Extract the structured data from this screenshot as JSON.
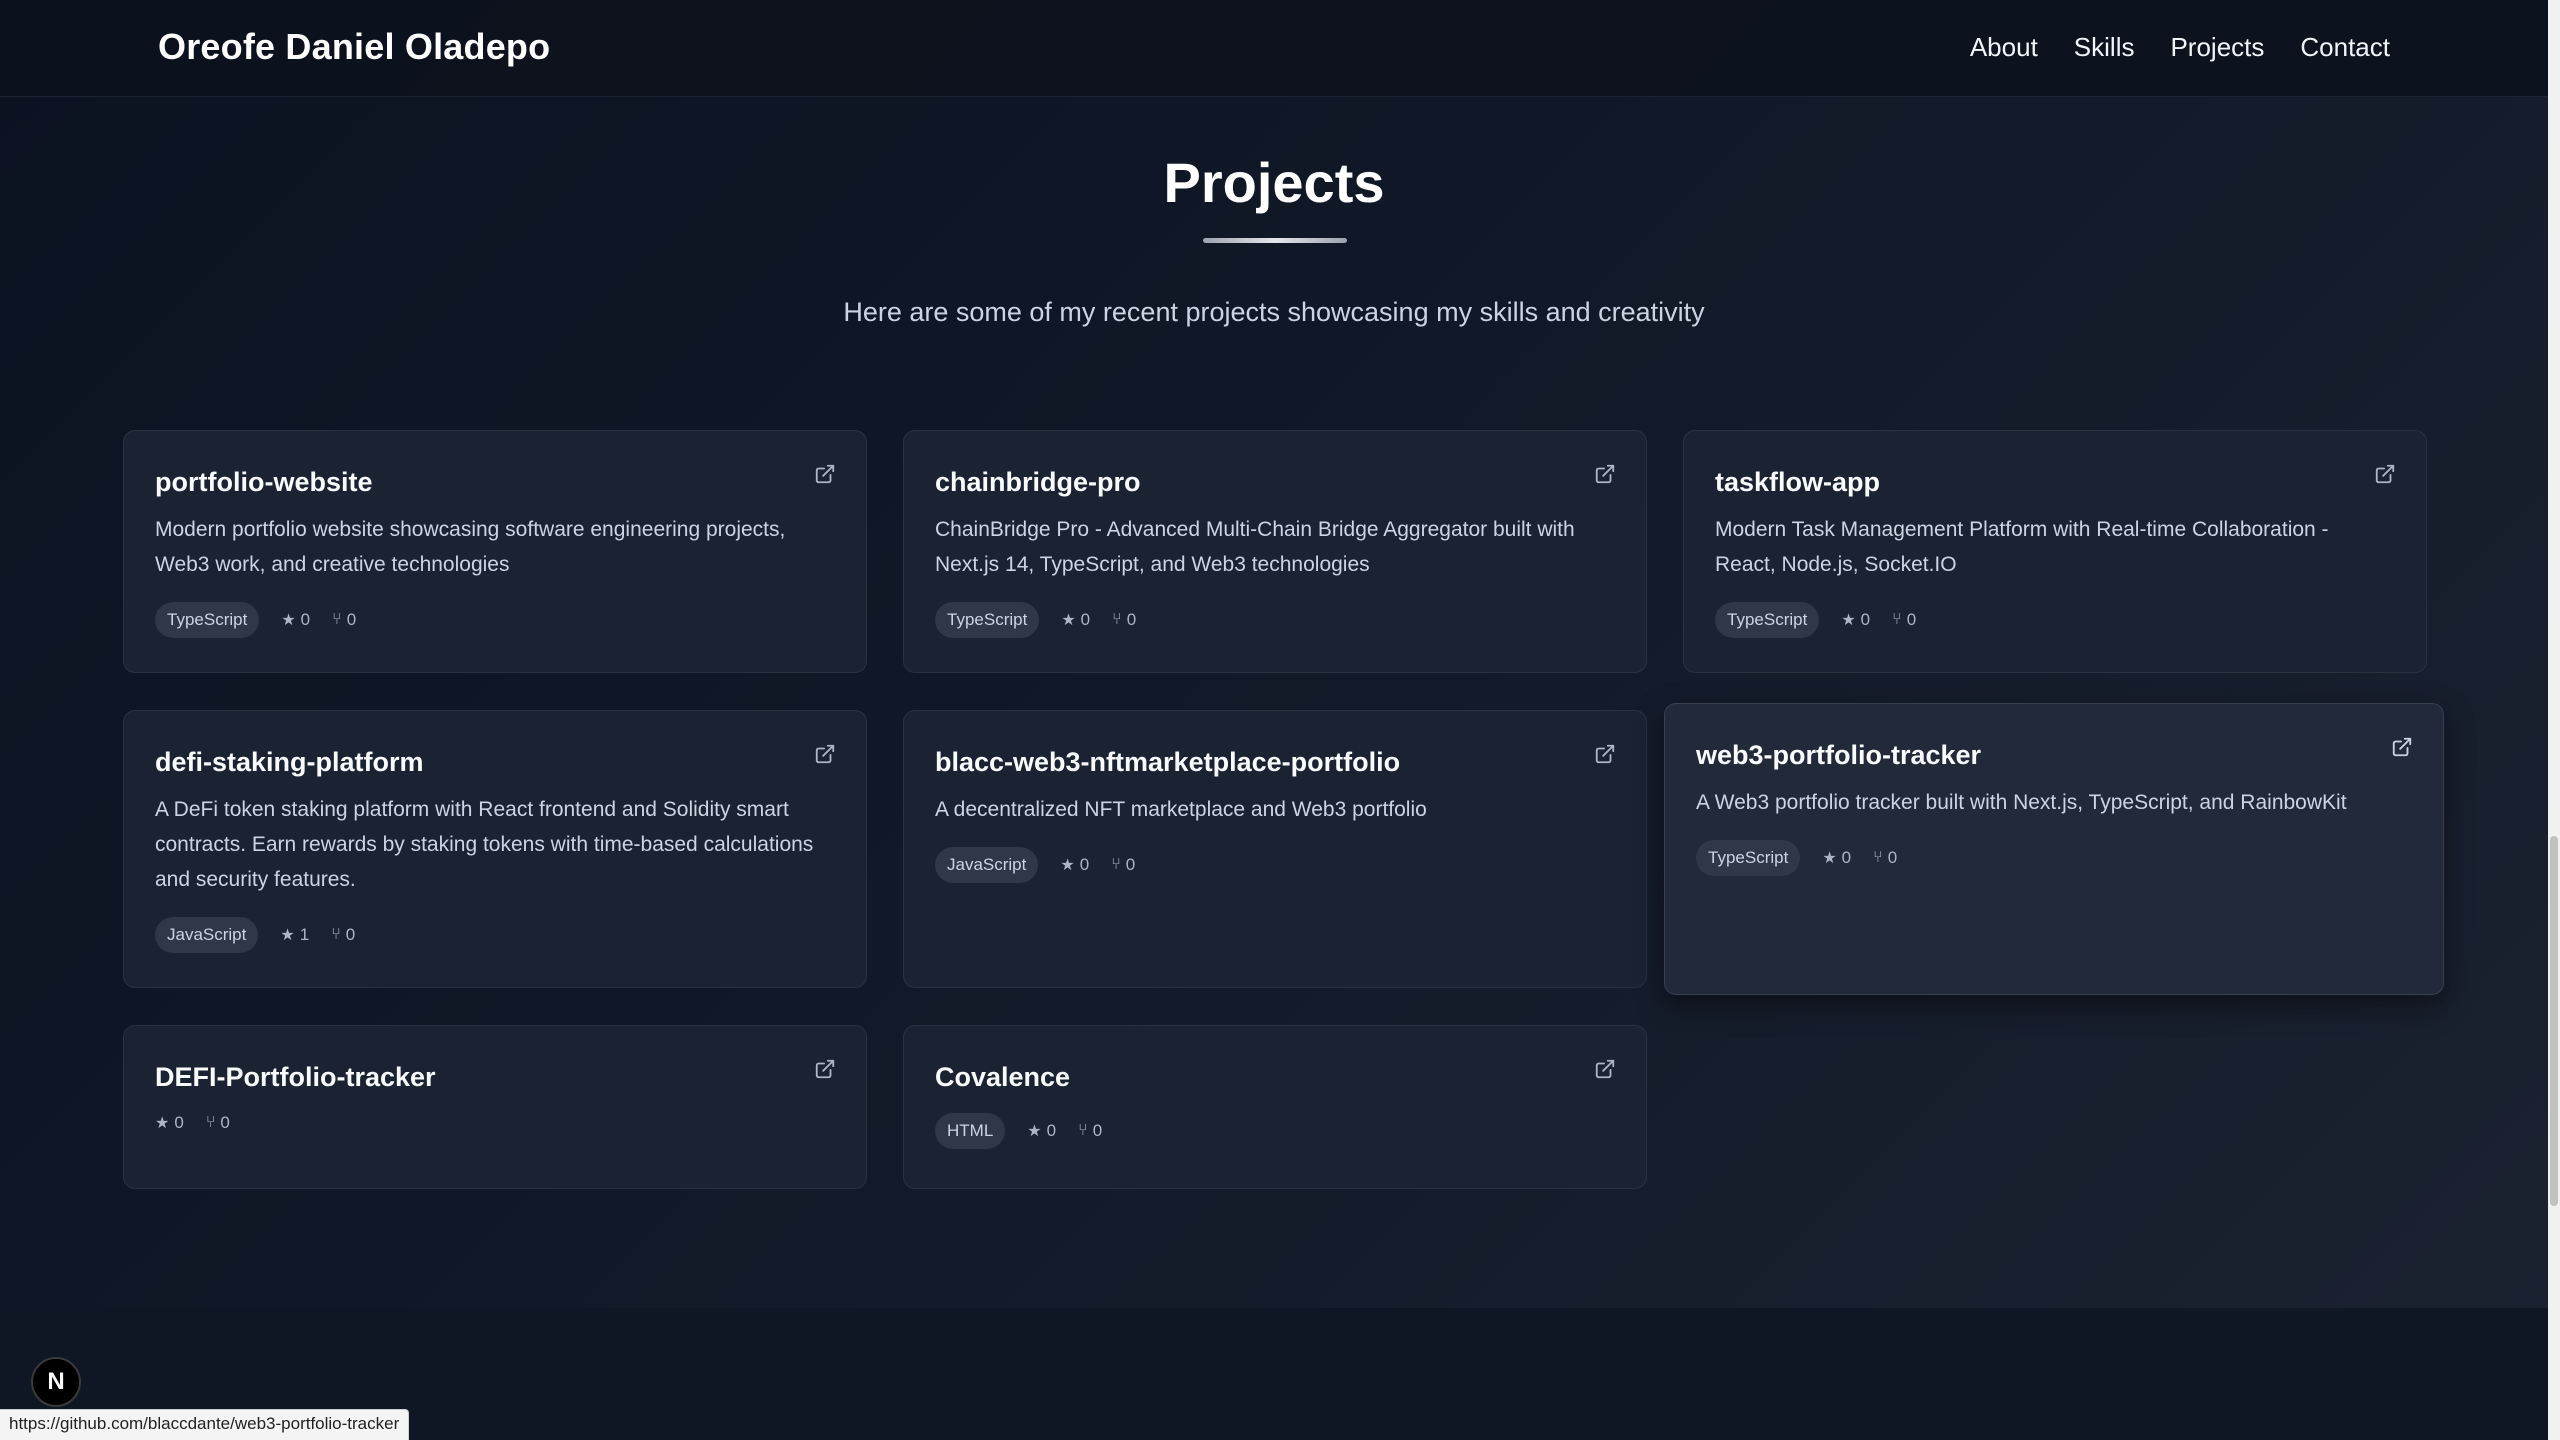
{
  "brand": "Oreofe Daniel Oladepo",
  "nav": [
    "About",
    "Skills",
    "Projects",
    "Contact"
  ],
  "section": {
    "title": "Projects",
    "subtitle": "Here are some of my recent projects showcasing my skills and creativity"
  },
  "projects": [
    {
      "name": "portfolio-website",
      "description": "Modern portfolio website showcasing software engineering projects, Web3 work, and creative technologies",
      "language": "TypeScript",
      "stars": "0",
      "forks": "0"
    },
    {
      "name": "chainbridge-pro",
      "description": "ChainBridge Pro - Advanced Multi-Chain Bridge Aggregator built with Next.js 14, TypeScript, and Web3 technologies",
      "language": "TypeScript",
      "stars": "0",
      "forks": "0"
    },
    {
      "name": "taskflow-app",
      "description": "Modern Task Management Platform with Real-time Collaboration - React, Node.js, Socket.IO",
      "language": "TypeScript",
      "stars": "0",
      "forks": "0"
    },
    {
      "name": "defi-staking-platform",
      "description": "A DeFi token staking platform with React frontend and Solidity smart contracts. Earn rewards by staking tokens with time-based calculations and security features.",
      "language": "JavaScript",
      "stars": "1",
      "forks": "0"
    },
    {
      "name": "blacc-web3-nftmarketplace-portfolio",
      "description": "A decentralized NFT marketplace and Web3 portfolio",
      "language": "JavaScript",
      "stars": "0",
      "forks": "0"
    },
    {
      "name": "web3-portfolio-tracker",
      "description": "A Web3 portfolio tracker built with Next.js, TypeScript, and RainbowKit",
      "language": "TypeScript",
      "stars": "0",
      "forks": "0"
    },
    {
      "name": "DEFI-Portfolio-tracker",
      "description": "",
      "language": "",
      "stars": "0",
      "forks": "0"
    },
    {
      "name": "Covalence",
      "description": "",
      "language": "HTML",
      "stars": "0",
      "forks": "0"
    }
  ],
  "icons": {
    "external": "external-link-icon",
    "star": "star-icon",
    "fork": "fork-icon"
  },
  "badge_letter": "N",
  "status_url": "https://github.com/blaccdante/web3-portfolio-tracker",
  "colors": {
    "background": "#0f1623",
    "card": "#1b2231",
    "badge": "#2f3847"
  }
}
